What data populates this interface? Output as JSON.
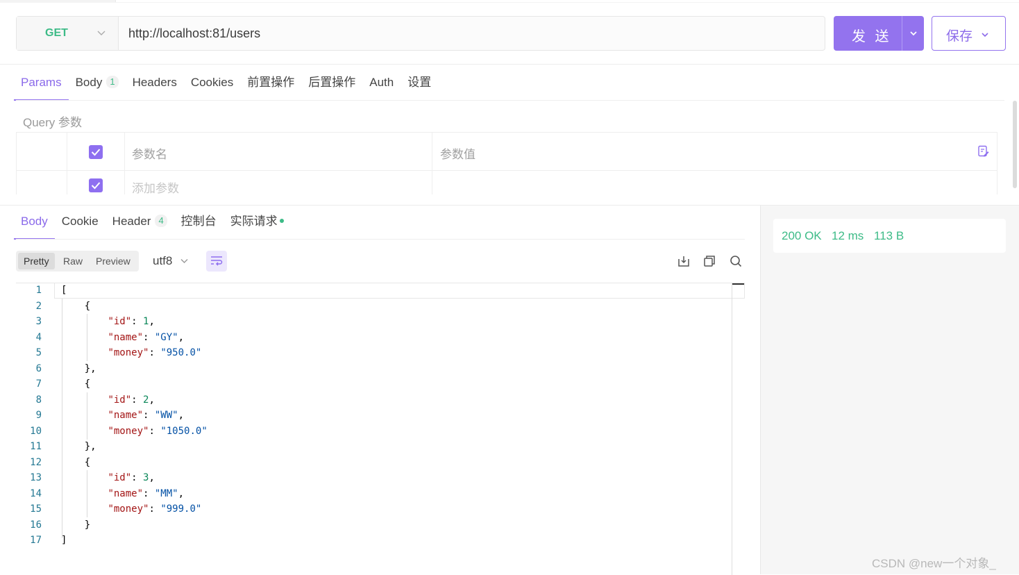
{
  "request": {
    "method": "GET",
    "url": "http://localhost:81/users",
    "send_label": "发 送",
    "save_label": "保存"
  },
  "request_tabs": [
    {
      "label": "Params",
      "active": true
    },
    {
      "label": "Body",
      "badge": "1"
    },
    {
      "label": "Headers"
    },
    {
      "label": "Cookies"
    },
    {
      "label": "前置操作"
    },
    {
      "label": "后置操作"
    },
    {
      "label": "Auth"
    },
    {
      "label": "设置"
    }
  ],
  "params": {
    "section_label": "Query 参数",
    "name_placeholder": "参数名",
    "value_placeholder": "参数值",
    "add_placeholder": "添加参数"
  },
  "response_tabs": [
    {
      "label": "Body",
      "active": true
    },
    {
      "label": "Cookie"
    },
    {
      "label": "Header",
      "badge": "4"
    },
    {
      "label": "控制台"
    },
    {
      "label": "实际请求",
      "dot": true
    }
  ],
  "view_modes": [
    "Pretty",
    "Raw",
    "Preview"
  ],
  "encoding": "utf8",
  "status": {
    "code": "200 OK",
    "time": "12 ms",
    "size": "113 B"
  },
  "response_body": [
    {
      "id": 1,
      "name": "GY",
      "money": "950.0"
    },
    {
      "id": 2,
      "name": "WW",
      "money": "1050.0"
    },
    {
      "id": 3,
      "name": "MM",
      "money": "999.0"
    }
  ],
  "line_numbers": [
    "1",
    "2",
    "3",
    "4",
    "5",
    "6",
    "7",
    "8",
    "9",
    "10",
    "11",
    "12",
    "13",
    "14",
    "15",
    "16",
    "17"
  ],
  "watermark": "CSDN @new一个对象_",
  "colors": {
    "accent": "#9373ee",
    "method_get": "#3dbb87",
    "status_ok": "#3dbb87"
  },
  "icons": {
    "method_dropdown": "chevron-down-icon",
    "param_edit": "bulk-edit-icon",
    "wrap": "word-wrap-icon",
    "download": "download-icon",
    "copy": "copy-icon",
    "search": "search-icon"
  }
}
